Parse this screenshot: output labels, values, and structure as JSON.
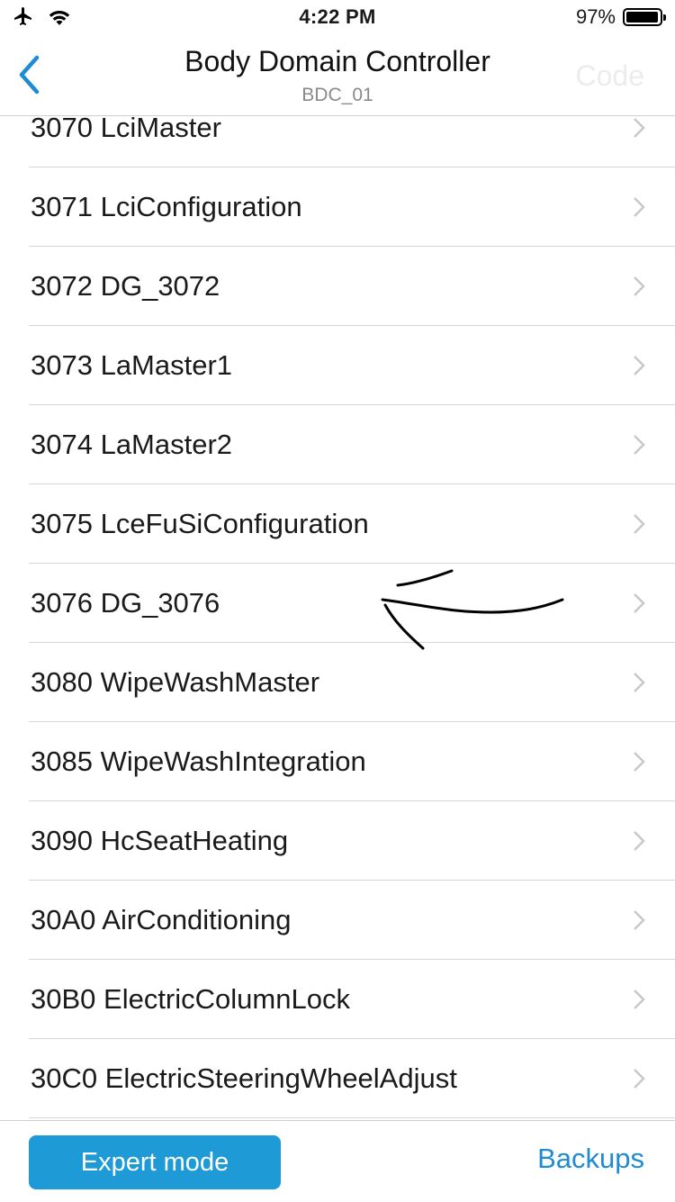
{
  "status_bar": {
    "time": "4:22 PM",
    "battery_percent": "97%",
    "battery_level": 0.97
  },
  "nav": {
    "title": "Body Domain Controller",
    "subtitle": "BDC_01",
    "right_action": "Code",
    "back_icon": "chevron-left-icon"
  },
  "list": {
    "items": [
      {
        "label": "3070 LciMaster"
      },
      {
        "label": "3071 LciConfiguration"
      },
      {
        "label": "3072 DG_3072"
      },
      {
        "label": "3073 LaMaster1"
      },
      {
        "label": "3074 LaMaster2"
      },
      {
        "label": "3075 LceFuSiConfiguration"
      },
      {
        "label": "3076 DG_3076"
      },
      {
        "label": "3080 WipeWashMaster"
      },
      {
        "label": "3085 WipeWashIntegration"
      },
      {
        "label": "3090 HcSeatHeating"
      },
      {
        "label": "30A0 AirConditioning"
      },
      {
        "label": "30B0 ElectricColumnLock"
      },
      {
        "label": "30C0 ElectricSteeringWheelAdjust"
      }
    ]
  },
  "bottom_bar": {
    "expert_mode_label": "Expert mode",
    "backups_label": "Backups"
  },
  "colors": {
    "accent": "#1e9ad6",
    "link": "#1e8bd2",
    "separator": "#d6d6d6",
    "chevron": "#c7c7cc"
  }
}
